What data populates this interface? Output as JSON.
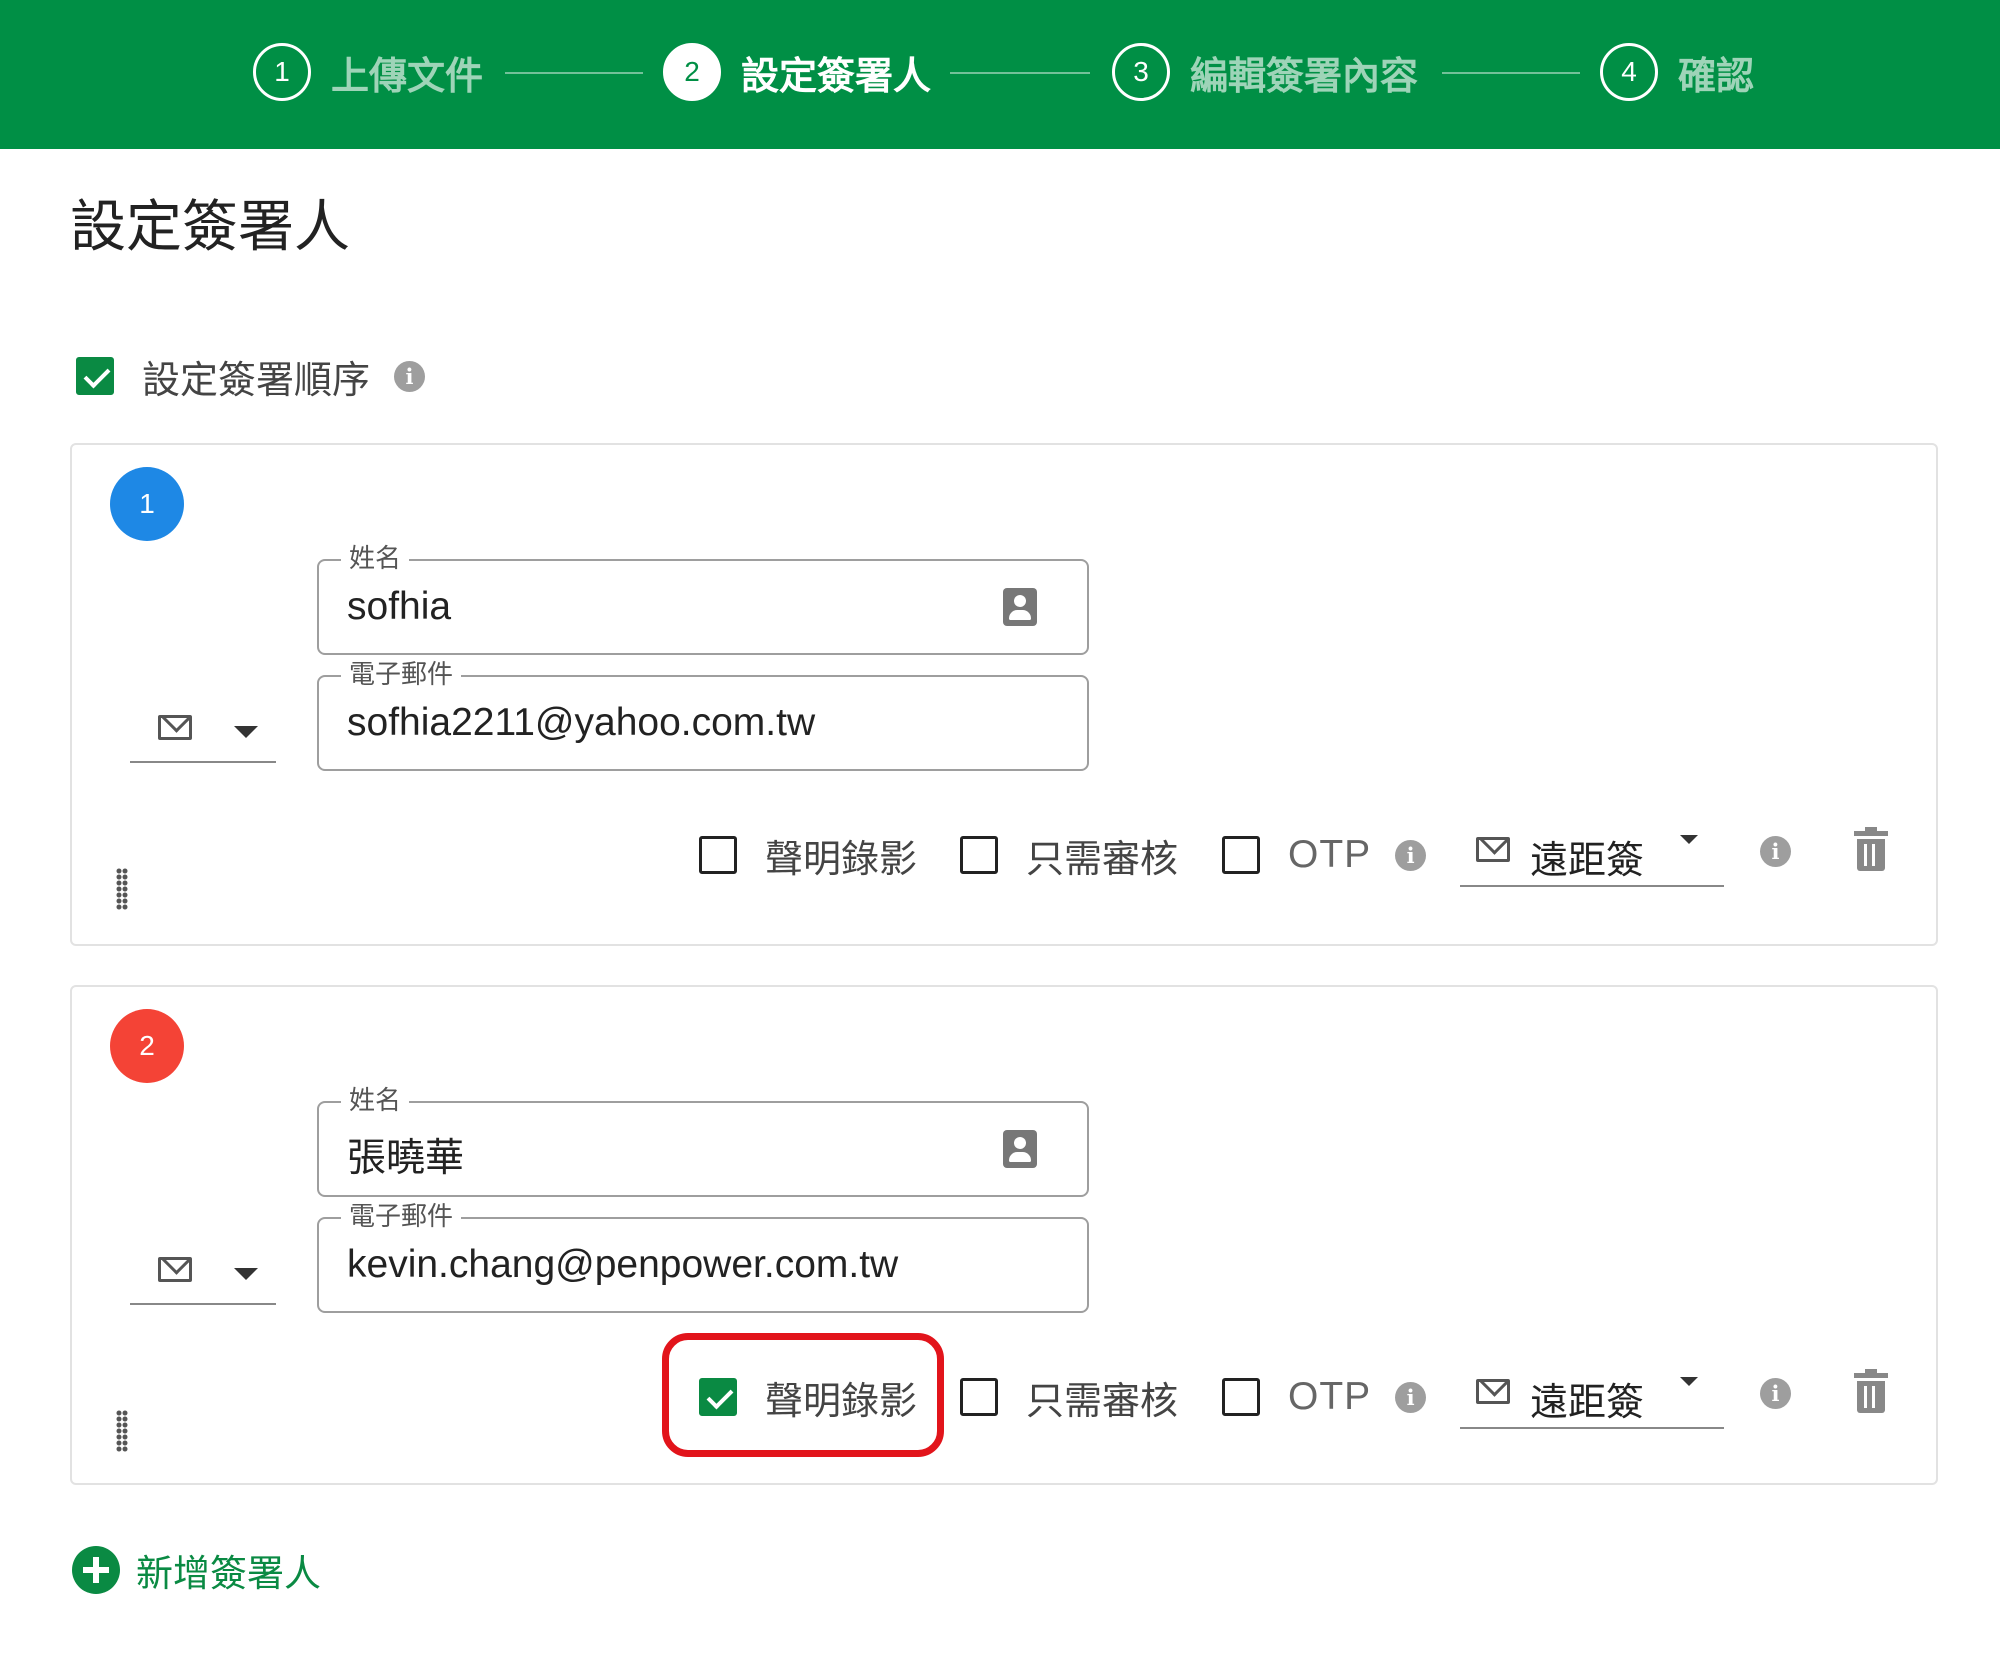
{
  "stepper": {
    "steps": [
      {
        "number": "1",
        "label": "上傳文件",
        "active": false
      },
      {
        "number": "2",
        "label": "設定簽署人",
        "active": true
      },
      {
        "number": "3",
        "label": "編輯簽署內容",
        "active": false
      },
      {
        "number": "4",
        "label": "確認",
        "active": false
      }
    ]
  },
  "page": {
    "title": "設定簽署人",
    "signing_order_label": "設定簽署順序",
    "signing_order_checked": true
  },
  "signers": [
    {
      "number": "1",
      "badge_color": "#1E88E5",
      "name_label": "姓名",
      "name_value": "sofhia",
      "email_label": "電子郵件",
      "email_value": "sofhia2211@yahoo.com.tw",
      "notify_icon": "mail-icon",
      "options": [
        {
          "label": "聲明錄影",
          "checked": false
        },
        {
          "label": "只需審核",
          "checked": false
        },
        {
          "label": "OTP",
          "checked": false
        }
      ],
      "sign_method": "遠距簽"
    },
    {
      "number": "2",
      "badge_color": "#F44336",
      "name_label": "姓名",
      "name_value": "張曉華",
      "email_label": "電子郵件",
      "email_value": "kevin.chang@penpower.com.tw",
      "notify_icon": "mail-icon",
      "options": [
        {
          "label": "聲明錄影",
          "checked": true
        },
        {
          "label": "只需審核",
          "checked": false
        },
        {
          "label": "OTP",
          "checked": false
        }
      ],
      "sign_method": "遠距簽"
    }
  ],
  "add_signer_label": "新增簽署人",
  "colors": {
    "brand_green": "#008F45",
    "checkbox_green": "#0A8A43",
    "highlight_red": "#E2141B"
  }
}
